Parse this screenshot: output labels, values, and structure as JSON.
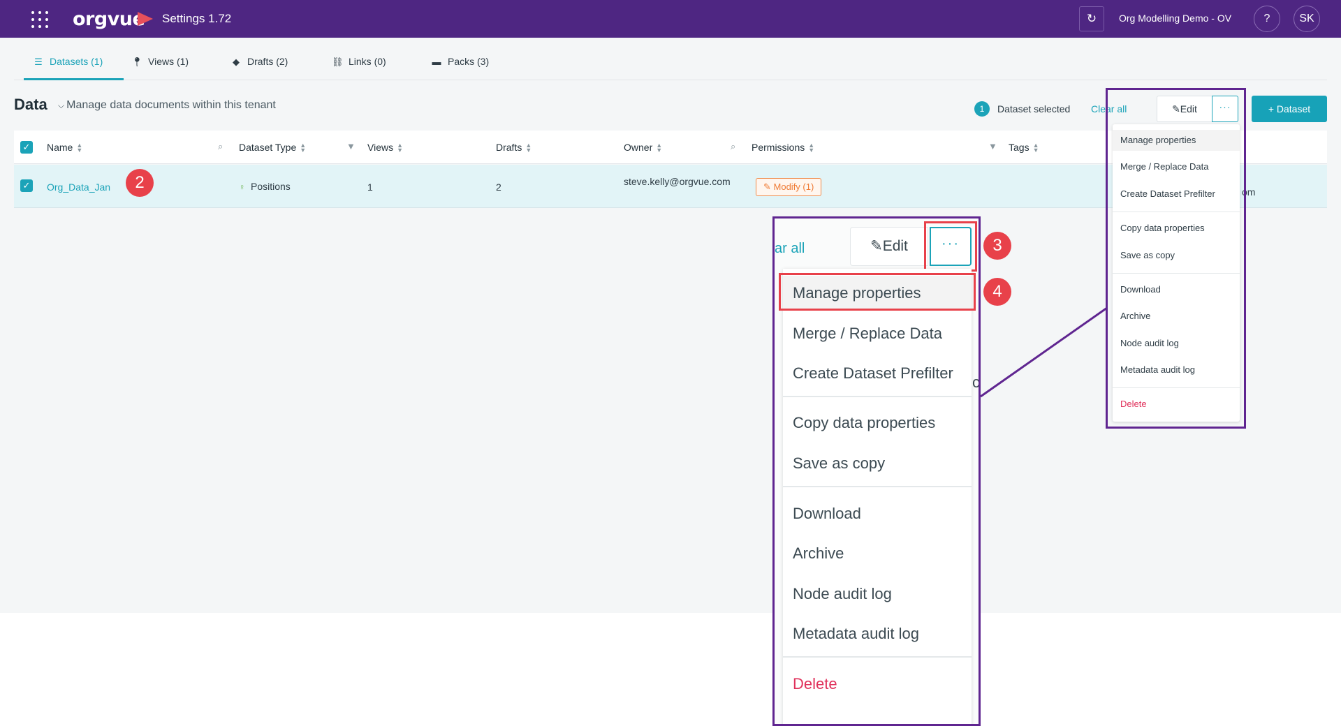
{
  "header": {
    "logo_text": "orgvue",
    "app_title": "Settings  1.72",
    "tenant": "Org Modelling Demo - OV",
    "help": "?",
    "avatar_initials": "SK"
  },
  "tabs": [
    {
      "label": "Datasets (1)",
      "icon": "database-icon",
      "active": true
    },
    {
      "label": "Views (1)",
      "icon": "pin-icon",
      "active": false
    },
    {
      "label": "Drafts (2)",
      "icon": "layers-icon",
      "active": false
    },
    {
      "label": "Links (0)",
      "icon": "link-icon",
      "active": false
    },
    {
      "label": "Packs (3)",
      "icon": "pack-icon",
      "active": false
    }
  ],
  "section": {
    "title": "Data",
    "subtitle": "Manage data documents within this tenant"
  },
  "selection": {
    "count": "1",
    "text": "Dataset selected",
    "clear_all": "Clear all",
    "edit_label": "Edit",
    "more_label": "···",
    "add_dataset_label": "+ Dataset"
  },
  "table": {
    "columns": [
      "Name",
      "Dataset Type",
      "Views",
      "Drafts",
      "Owner",
      "Permissions",
      "Tags"
    ],
    "rows": [
      {
        "name": "Org_Data_Jan",
        "dataset_type": "Positions",
        "views": "1",
        "drafts": "2",
        "owner": "steve.kelly@orgvue.com",
        "permission": "Modify (1)",
        "tail": "om"
      }
    ]
  },
  "menu": {
    "items": [
      "Manage properties",
      "Merge / Replace Data",
      "Create Dataset Prefilter",
      "Copy data properties",
      "Save as copy",
      "Download",
      "Archive",
      "Node audit log",
      "Metadata audit log",
      "Delete"
    ]
  },
  "zoom": {
    "clear_fragment": "ar all",
    "edit_label": "Edit",
    "edge_fragment": "c"
  },
  "steps": [
    "2",
    "3",
    "4"
  ],
  "colors": {
    "header": "#4e2682",
    "accent": "#1ba3b8",
    "annotation_frame": "#5f2590",
    "step_badge": "#e8414a",
    "danger": "#e0315b",
    "permission": "#ef7b35"
  }
}
